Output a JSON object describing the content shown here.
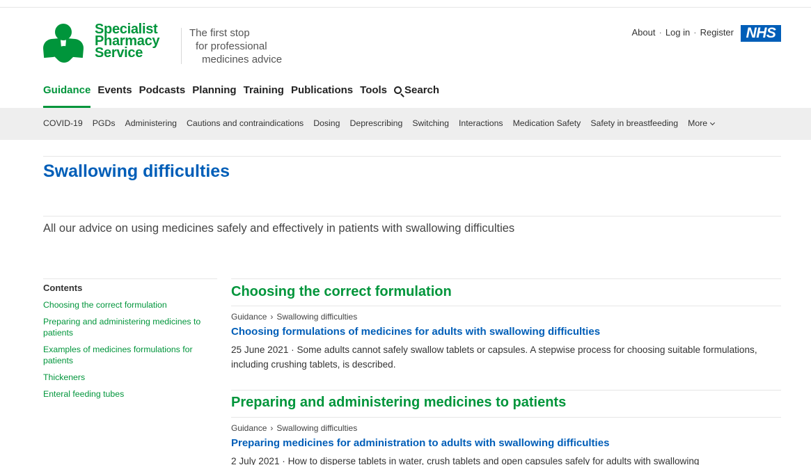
{
  "brand": {
    "name_lines": [
      "Specialist",
      "Pharmacy",
      "Service"
    ],
    "tagline_lines": [
      "The first stop",
      "for professional",
      "medicines advice"
    ],
    "color": "#00953b"
  },
  "account": {
    "about": "About",
    "separator": "·",
    "login": "Log in",
    "register": "Register",
    "nhs_logo": "NHS",
    "nhs_color": "#005eb8"
  },
  "main_nav": {
    "items": [
      "Guidance",
      "Events",
      "Podcasts",
      "Planning",
      "Training",
      "Publications",
      "Tools"
    ],
    "search_label": "Search",
    "active": "Guidance"
  },
  "sub_nav": {
    "items": [
      "COVID-19",
      "PGDs",
      "Administering",
      "Cautions and contraindications",
      "Dosing",
      "Deprescribing",
      "Switching",
      "Interactions",
      "Medication Safety",
      "Safety in breastfeeding"
    ],
    "more_label": "More"
  },
  "page": {
    "title": "Swallowing difficulties",
    "intro": "All our advice on using medicines safely and effectively in patients with swallowing difficulties"
  },
  "contents": {
    "heading": "Contents",
    "items": [
      "Choosing the correct formulation",
      "Preparing and administering medicines to patients",
      "Examples of medicines formulations for patients",
      "Thickeners",
      "Enteral feeding tubes"
    ]
  },
  "sections": [
    {
      "title": "Choosing the correct formulation",
      "breadcrumb": [
        "Guidance",
        "Swallowing difficulties"
      ],
      "article_title": "Choosing formulations of medicines for adults with swallowing difficulties",
      "summary": "25 June 2021 · Some adults cannot safely swallow tablets or capsules. A stepwise process for choosing suitable formulations, including crushing tablets, is described."
    },
    {
      "title": "Preparing and administering medicines to patients",
      "breadcrumb": [
        "Guidance",
        "Swallowing difficulties"
      ],
      "article_title": "Preparing medicines for administration to adults with swallowing difficulties",
      "summary": "2 July 2021 · How to disperse tablets in water, crush tablets and open capsules safely for adults with swallowing"
    }
  ],
  "breadcrumb_arrow": "›"
}
